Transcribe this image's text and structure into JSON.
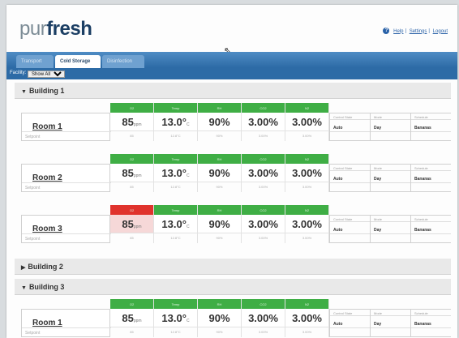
{
  "brand": {
    "pur": "pur",
    "fresh": "fresh"
  },
  "toplinks": {
    "help": "Help",
    "settings": "Settings",
    "logout": "Logout"
  },
  "tabs": [
    {
      "label": "Transport",
      "active": false
    },
    {
      "label": "Cold Storage",
      "active": true
    },
    {
      "label": "Disinfection",
      "active": false
    }
  ],
  "filter": {
    "label": "Facility:",
    "value": "Show All"
  },
  "metric_headers": [
    "O2",
    "Temp",
    "RH",
    "CO2",
    "N2"
  ],
  "control_headers": [
    "Control State",
    "Mode",
    "Schedule"
  ],
  "setpoint_label": "Setpoint",
  "buildings": [
    {
      "name": "Building 1",
      "expanded": true,
      "rooms": [
        {
          "name": "Room 1",
          "alarm": false,
          "values": [
            "85",
            "13.0°",
            "90%",
            "3.00%",
            "3.00%"
          ],
          "units": [
            "ppm",
            "C",
            "",
            "",
            ""
          ],
          "setpoints": [
            "85",
            "12.8°C",
            "90%",
            "3.00%",
            "3.00%"
          ],
          "control": [
            "Auto",
            "Day",
            "Bananas"
          ]
        },
        {
          "name": "Room 2",
          "alarm": false,
          "values": [
            "85",
            "13.0°",
            "90%",
            "3.00%",
            "3.00%"
          ],
          "units": [
            "ppm",
            "C",
            "",
            "",
            ""
          ],
          "setpoints": [
            "85",
            "12.8°C",
            "90%",
            "3.00%",
            "3.00%"
          ],
          "control": [
            "Auto",
            "Day",
            "Bananas"
          ]
        },
        {
          "name": "Room 3",
          "alarm": true,
          "values": [
            "85",
            "13.0°",
            "90%",
            "3.00%",
            "3.00%"
          ],
          "units": [
            "ppm",
            "C",
            "",
            "",
            ""
          ],
          "setpoints": [
            "85",
            "12.8°C",
            "90%",
            "3.00%",
            "3.00%"
          ],
          "control": [
            "Auto",
            "Day",
            "Bananas"
          ]
        }
      ]
    },
    {
      "name": "Building 2",
      "expanded": false,
      "rooms": []
    },
    {
      "name": "Building 3",
      "expanded": true,
      "rooms": [
        {
          "name": "Room 1",
          "alarm": false,
          "values": [
            "85",
            "13.0°",
            "90%",
            "3.00%",
            "3.00%"
          ],
          "units": [
            "ppm",
            "C",
            "",
            "",
            ""
          ],
          "setpoints": [
            "85",
            "12.8°C",
            "90%",
            "3.00%",
            "3.00%"
          ],
          "control": [
            "Auto",
            "Day",
            "Bananas"
          ]
        }
      ]
    }
  ]
}
